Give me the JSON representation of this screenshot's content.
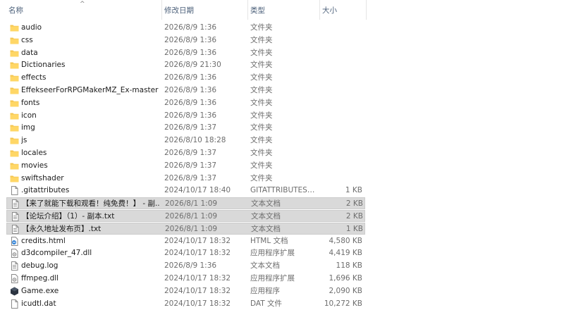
{
  "columns": {
    "name": "名称",
    "date": "修改日期",
    "type": "类型",
    "size": "大小"
  },
  "files": [
    {
      "name": "audio",
      "date": "2026/8/9 1:36",
      "type": "文件夹",
      "size": "",
      "icon": "folder-icon",
      "selected": false
    },
    {
      "name": "css",
      "date": "2026/8/9 1:36",
      "type": "文件夹",
      "size": "",
      "icon": "folder-icon",
      "selected": false
    },
    {
      "name": "data",
      "date": "2026/8/9 1:36",
      "type": "文件夹",
      "size": "",
      "icon": "folder-icon",
      "selected": false
    },
    {
      "name": "Dictionaries",
      "date": "2026/8/9 21:30",
      "type": "文件夹",
      "size": "",
      "icon": "folder-icon",
      "selected": false
    },
    {
      "name": "effects",
      "date": "2026/8/9 1:36",
      "type": "文件夹",
      "size": "",
      "icon": "folder-icon",
      "selected": false
    },
    {
      "name": "EffekseerForRPGMakerMZ_Ex-master",
      "date": "2026/8/9 1:36",
      "type": "文件夹",
      "size": "",
      "icon": "folder-icon",
      "selected": false
    },
    {
      "name": "fonts",
      "date": "2026/8/9 1:36",
      "type": "文件夹",
      "size": "",
      "icon": "folder-icon",
      "selected": false
    },
    {
      "name": "icon",
      "date": "2026/8/9 1:36",
      "type": "文件夹",
      "size": "",
      "icon": "folder-icon",
      "selected": false
    },
    {
      "name": "img",
      "date": "2026/8/9 1:37",
      "type": "文件夹",
      "size": "",
      "icon": "folder-icon",
      "selected": false
    },
    {
      "name": "js",
      "date": "2026/8/10 18:28",
      "type": "文件夹",
      "size": "",
      "icon": "folder-icon",
      "selected": false
    },
    {
      "name": "locales",
      "date": "2026/8/9 1:37",
      "type": "文件夹",
      "size": "",
      "icon": "folder-icon",
      "selected": false
    },
    {
      "name": "movies",
      "date": "2026/8/9 1:37",
      "type": "文件夹",
      "size": "",
      "icon": "folder-icon",
      "selected": false
    },
    {
      "name": "swiftshader",
      "date": "2026/8/9 1:37",
      "type": "文件夹",
      "size": "",
      "icon": "folder-icon",
      "selected": false
    },
    {
      "name": ".gitattributes",
      "date": "2024/10/17 18:40",
      "type": "GITATTRIBUTES ...",
      "size": "1 KB",
      "icon": "file-icon",
      "selected": false
    },
    {
      "name": "【来了就能下载和观看！纯免费！】 - 副...",
      "date": "2026/8/1 1:09",
      "type": "文本文档",
      "size": "2 KB",
      "icon": "text-file-icon",
      "selected": true
    },
    {
      "name": "【论坛介绍】（1）- 副本.txt",
      "date": "2026/8/1 1:09",
      "type": "文本文档",
      "size": "2 KB",
      "icon": "text-file-icon",
      "selected": true
    },
    {
      "name": "【永久地址发布页】.txt",
      "date": "2026/8/1 1:09",
      "type": "文本文档",
      "size": "1 KB",
      "icon": "text-file-icon",
      "selected": true
    },
    {
      "name": "credits.html",
      "date": "2024/10/17 18:32",
      "type": "HTML 文档",
      "size": "4,580 KB",
      "icon": "html-file-icon",
      "selected": false
    },
    {
      "name": "d3dcompiler_47.dll",
      "date": "2024/10/17 18:32",
      "type": "应用程序扩展",
      "size": "4,419 KB",
      "icon": "dll-file-icon",
      "selected": false
    },
    {
      "name": "debug.log",
      "date": "2026/8/9 1:36",
      "type": "文本文档",
      "size": "118 KB",
      "icon": "text-file-icon",
      "selected": false
    },
    {
      "name": "ffmpeg.dll",
      "date": "2024/10/17 18:32",
      "type": "应用程序扩展",
      "size": "1,696 KB",
      "icon": "dll-file-icon",
      "selected": false
    },
    {
      "name": "Game.exe",
      "date": "2024/10/17 18:32",
      "type": "应用程序",
      "size": "2,090 KB",
      "icon": "app-icon",
      "selected": false
    },
    {
      "name": "icudtl.dat",
      "date": "2024/10/17 18:32",
      "type": "DAT 文件",
      "size": "10,272 KB",
      "icon": "file-icon",
      "selected": false
    }
  ]
}
